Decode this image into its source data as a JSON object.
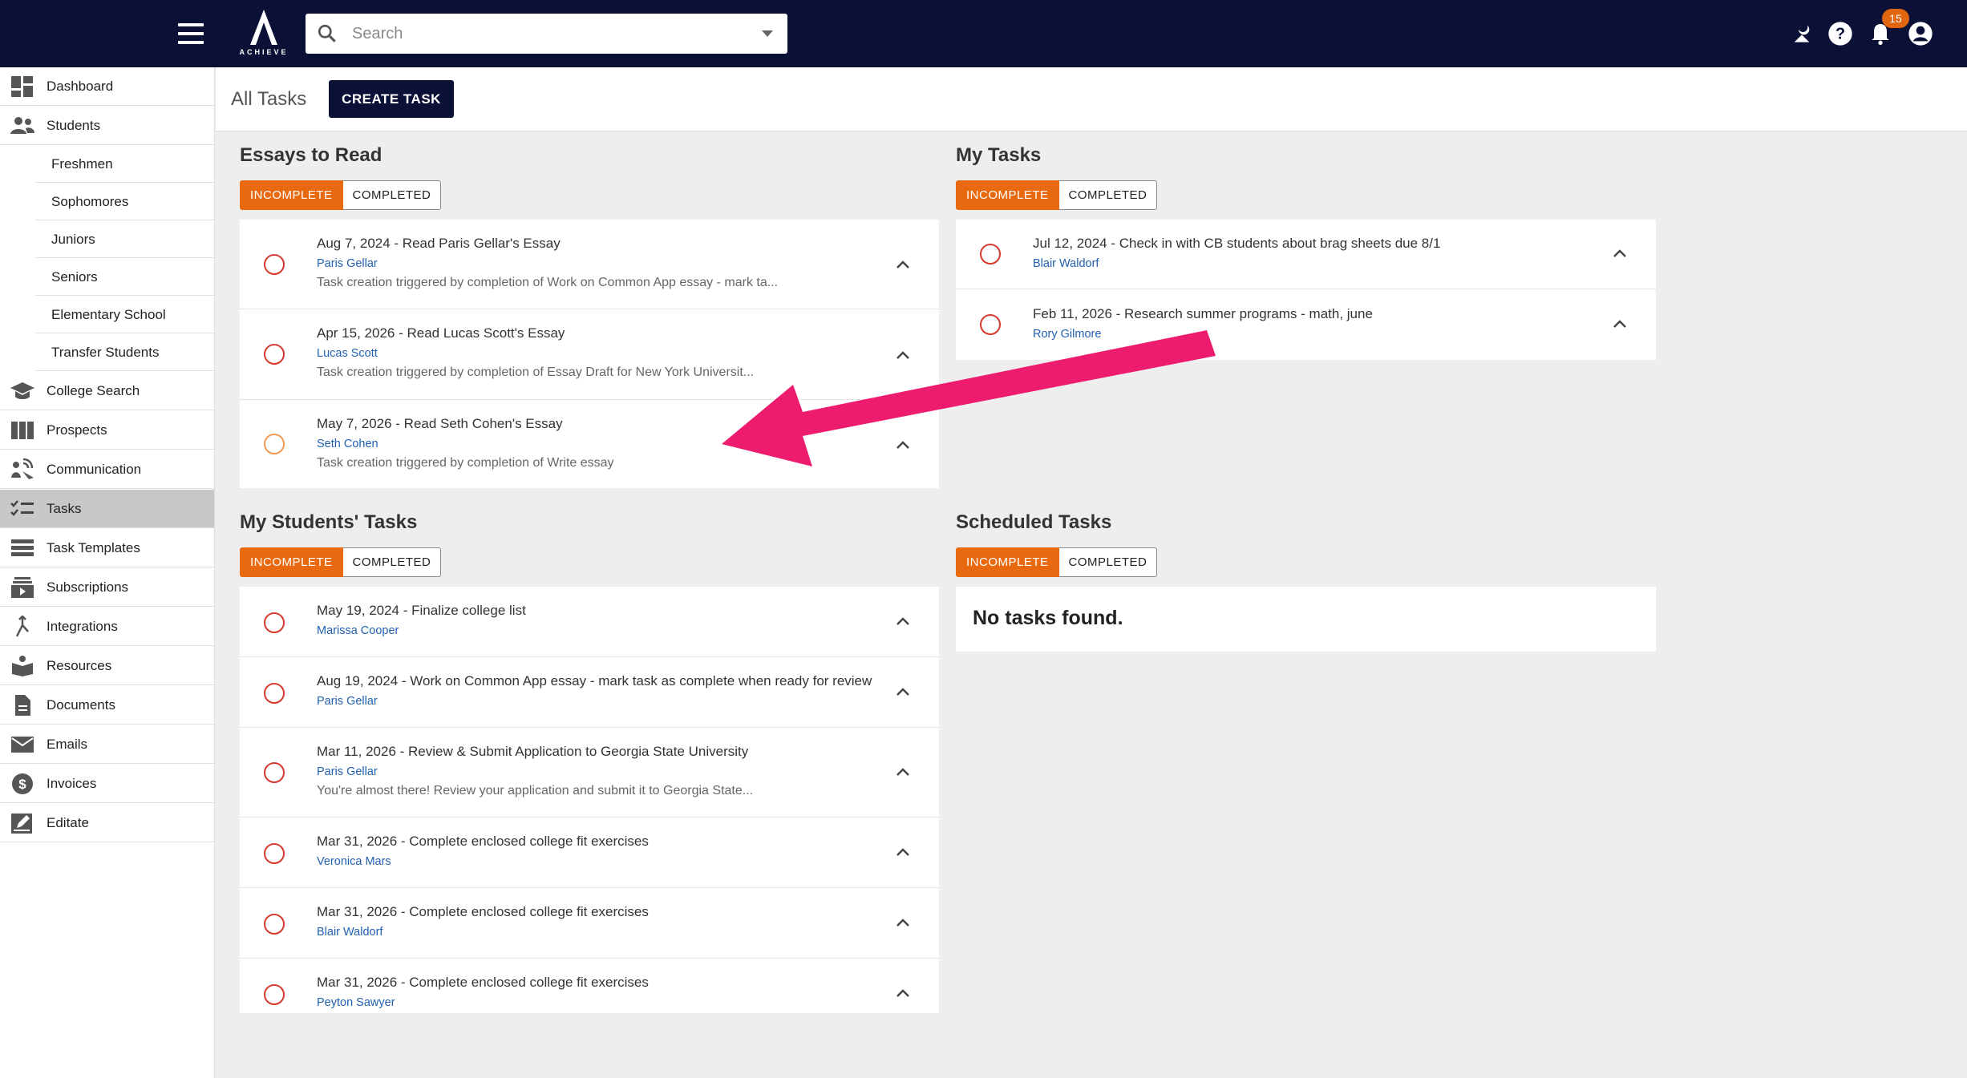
{
  "app": {
    "logo_text": "ACHIEVE",
    "search": {
      "placeholder": "Search"
    },
    "notifications_count": "15",
    "top_icons": [
      "theme-toggle-icon",
      "help-icon",
      "bell-icon",
      "account-icon"
    ]
  },
  "sidebar": {
    "items": [
      {
        "label": "Dashboard",
        "icon": "dashboard-icon"
      },
      {
        "label": "Students",
        "icon": "people-icon"
      },
      {
        "label": "College Search",
        "icon": "graduation-cap-icon"
      },
      {
        "label": "Prospects",
        "icon": "columns-icon"
      },
      {
        "label": "Communication",
        "icon": "communication-icon"
      },
      {
        "label": "Tasks",
        "icon": "checklist-icon",
        "active": true
      },
      {
        "label": "Task Templates",
        "icon": "list-icon"
      },
      {
        "label": "Subscriptions",
        "icon": "subscriptions-icon"
      },
      {
        "label": "Integrations",
        "icon": "merge-icon"
      },
      {
        "label": "Resources",
        "icon": "resources-icon"
      },
      {
        "label": "Documents",
        "icon": "document-icon"
      },
      {
        "label": "Emails",
        "icon": "mail-icon"
      },
      {
        "label": "Invoices",
        "icon": "dollar-icon"
      },
      {
        "label": "Editate",
        "icon": "edit-icon"
      }
    ],
    "student_subitems": [
      "Freshmen",
      "Sophomores",
      "Juniors",
      "Seniors",
      "Elementary School",
      "Transfer Students"
    ]
  },
  "header": {
    "title": "All Tasks",
    "create_label": "CREATE TASK"
  },
  "toggle": {
    "incomplete": "INCOMPLETE",
    "completed": "COMPLETED"
  },
  "essays": {
    "title": "Essays to Read",
    "tasks": [
      {
        "title": "Aug 7, 2024 - Read Paris Gellar's Essay",
        "name": "Paris Gellar",
        "desc": "Task creation triggered by completion of Work on Common App essay - mark ta..."
      },
      {
        "title": "Apr 15, 2026 - Read Lucas Scott's Essay",
        "name": "Lucas Scott",
        "desc": "Task creation triggered by completion of Essay Draft for New York Universit..."
      },
      {
        "title": "May 7, 2026 - Read Seth Cohen's Essay",
        "name": "Seth Cohen",
        "desc": "Task creation triggered by completion of Write essay"
      }
    ]
  },
  "my_tasks": {
    "title": "My Tasks",
    "tasks": [
      {
        "title": "Jul 12, 2024 - Check in with CB students about brag sheets due 8/1",
        "name": "Blair Waldorf"
      },
      {
        "title": "Feb 11, 2026 - Research summer programs - math, june",
        "name": "Rory Gilmore"
      }
    ]
  },
  "students_tasks": {
    "title": "My Students' Tasks",
    "tasks": [
      {
        "title": "May 19, 2024 - Finalize college list",
        "name": "Marissa Cooper"
      },
      {
        "title": "Aug 19, 2024 - Work on Common App essay - mark task as complete when ready for review",
        "name": "Paris Gellar"
      },
      {
        "title": "Mar 11, 2026 - Review & Submit Application to Georgia State University",
        "name": "Paris Gellar",
        "desc": "You're almost there! Review your application and submit it to Georgia State..."
      },
      {
        "title": "Mar 31, 2026 - Complete enclosed college fit exercises",
        "name": "Veronica Mars"
      },
      {
        "title": "Mar 31, 2026 - Complete enclosed college fit exercises",
        "name": "Blair Waldorf"
      },
      {
        "title": "Mar 31, 2026 - Complete enclosed college fit exercises",
        "name": "Peyton Sawyer"
      }
    ]
  },
  "scheduled": {
    "title": "Scheduled Tasks",
    "empty_text": "No tasks found."
  },
  "colors": {
    "topbar": "#0b1136",
    "accent": "#e8690f",
    "annotation_arrow": "#ee1c6e",
    "link": "#2261b1",
    "circle": "#d53a2e"
  }
}
